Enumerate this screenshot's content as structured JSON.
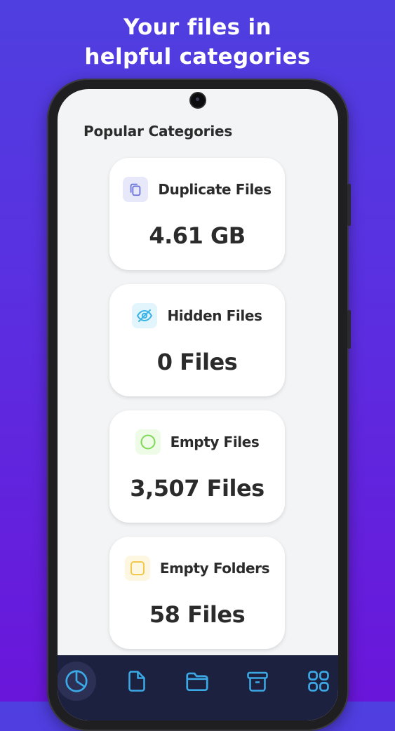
{
  "promo": {
    "line1": "Your files in",
    "line2": "helpful categories"
  },
  "screen": {
    "section_title": "Popular Categories",
    "categories": [
      {
        "label": "Duplicate Files",
        "value": "4.61 GB",
        "icon": "duplicate-copy-icon",
        "icon_color": "#6b74d6",
        "icon_bg": "#e7e9fb"
      },
      {
        "label": "Hidden Files",
        "value": "0 Files",
        "icon": "eye-off-icon",
        "icon_color": "#3bb3e6",
        "icon_bg": "#e3f5fc"
      },
      {
        "label": "Empty Files",
        "value": "3,507 Files",
        "icon": "empty-circle-icon",
        "icon_color": "#7ed957",
        "icon_bg": "#eefbe7"
      },
      {
        "label": "Empty Folders",
        "value": "58 Files",
        "icon": "empty-square-icon",
        "icon_color": "#f2c94c",
        "icon_bg": "#fdf7e1"
      }
    ]
  },
  "bottom_nav": {
    "items": [
      {
        "icon": "pie-chart-icon",
        "active": true
      },
      {
        "icon": "file-icon",
        "active": false
      },
      {
        "icon": "folder-icon",
        "active": false
      },
      {
        "icon": "archive-box-icon",
        "active": false
      },
      {
        "icon": "grid-apps-icon",
        "active": false
      }
    ],
    "icon_color": "#3ba9e6",
    "background": "#1d2140"
  }
}
